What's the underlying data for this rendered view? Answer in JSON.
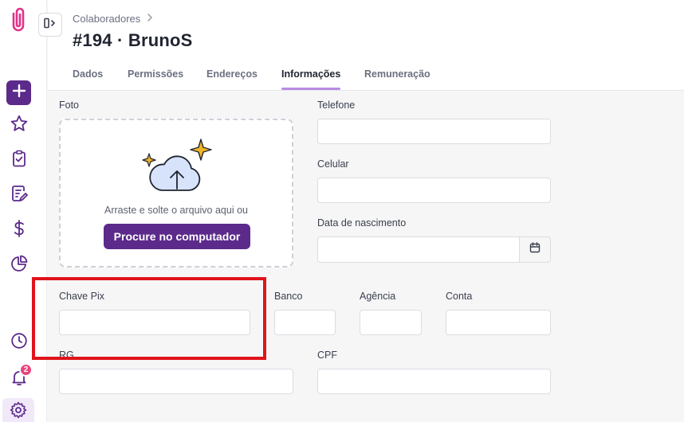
{
  "breadcrumb": {
    "parent": "Colaboradores"
  },
  "page": {
    "title": "#194 · BrunoS"
  },
  "tabs": [
    {
      "label": "Dados"
    },
    {
      "label": "Permissões"
    },
    {
      "label": "Endereços"
    },
    {
      "label": "Informações"
    },
    {
      "label": "Remuneração"
    }
  ],
  "active_tab": "Informações",
  "notifications": {
    "count": "2"
  },
  "form": {
    "foto": {
      "label": "Foto",
      "drop_text": "Arraste e solte o arquivo aqui ou",
      "button_label": "Procure no computador"
    },
    "telefone": {
      "label": "Telefone",
      "value": ""
    },
    "celular": {
      "label": "Celular",
      "value": ""
    },
    "data_nascimento": {
      "label": "Data de nascimento",
      "value": ""
    },
    "chave_pix": {
      "label": "Chave Pix",
      "value": ""
    },
    "banco": {
      "label": "Banco",
      "value": ""
    },
    "agencia": {
      "label": "Agência",
      "value": ""
    },
    "conta": {
      "label": "Conta",
      "value": ""
    },
    "rg": {
      "label": "RG",
      "value": ""
    },
    "cpf": {
      "label": "CPF",
      "value": ""
    }
  },
  "icons": {
    "logo": "paperclip-icon",
    "sidebar": [
      "plus-icon",
      "star-icon",
      "clipboard-check-icon",
      "edit-document-icon",
      "dollar-icon",
      "pie-chart-icon",
      "clock-icon",
      "bell-icon",
      "gear-icon"
    ],
    "calendar": "calendar-icon"
  },
  "colors": {
    "brand": "#5b2a8a",
    "accent": "#b78ce3",
    "badge": "#e8457c",
    "highlight": "#e0131b"
  }
}
